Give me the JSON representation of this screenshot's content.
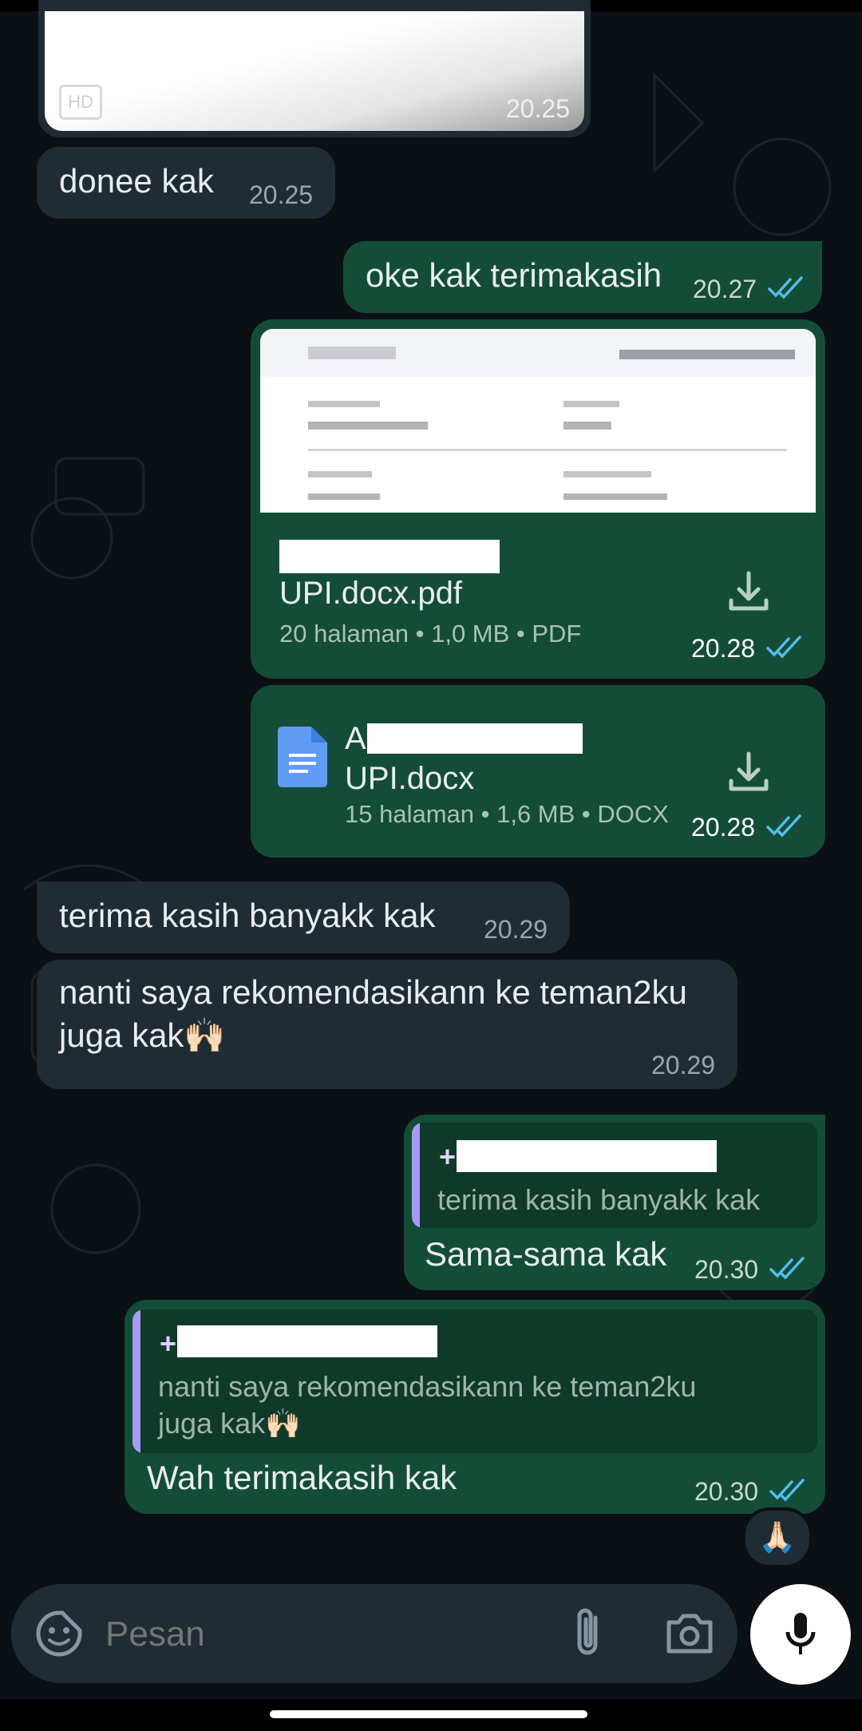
{
  "messages": {
    "image_time": "20.25",
    "hd_badge": "HD",
    "m1": {
      "text": "donee kak",
      "time": "20.25"
    },
    "m2": {
      "text": "oke kak terimakasih",
      "time": "20.27"
    },
    "doc1": {
      "filename": "UPI.docx.pdf",
      "meta": "20 halaman • 1,0 MB • PDF",
      "time": "20.28"
    },
    "doc2": {
      "filename_prefix": "A",
      "filename": "UPI.docx",
      "meta": "15 halaman • 1,6 MB • DOCX",
      "time": "20.28"
    },
    "m3": {
      "text": "terima kasih banyakk kak",
      "time": "20.29"
    },
    "m4": {
      "line1": "nanti saya rekomendasikann ke teman2ku",
      "line2": "juga kak🙌🏻",
      "time": "20.29"
    },
    "m5": {
      "quote_sender": "+",
      "quote_text": "terima kasih banyakk kak",
      "text": "Sama-sama kak",
      "time": "20.30"
    },
    "m6": {
      "quote_sender": "+",
      "quote_line1": "nanti saya rekomendasikann ke teman2ku",
      "quote_line2": "juga kak🙌🏻",
      "text": "Wah terimakasih kak",
      "time": "20.30"
    },
    "reaction": "🙏🏻"
  },
  "composer": {
    "placeholder": "Pesan"
  },
  "colors": {
    "outgoing": "#144d37",
    "incoming": "#202c33",
    "ticks": "#53bdeb",
    "quote_bar": "#a79bf5"
  },
  "icons": [
    "sticker-icon",
    "attach-icon",
    "camera-icon",
    "mic-icon",
    "download-icon",
    "doc-icon",
    "double-check-icon"
  ]
}
